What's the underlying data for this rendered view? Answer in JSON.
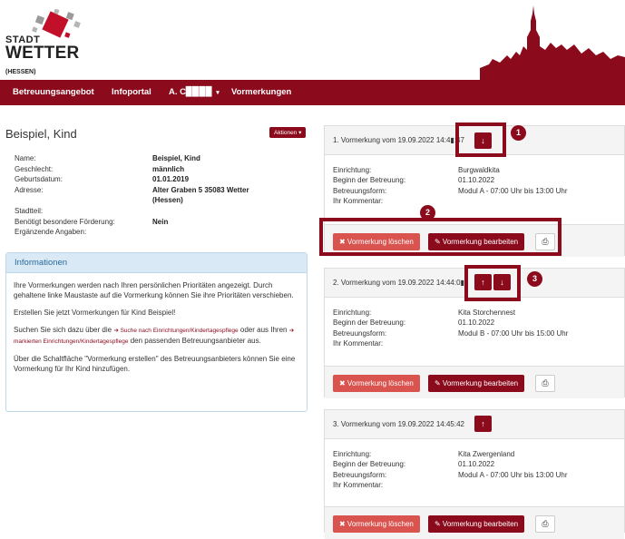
{
  "logo": {
    "line1": "STADT",
    "line2": "WETTER",
    "line3": "(HESSEN)"
  },
  "nav": {
    "items": [
      "Betreuungsangebot",
      "Infoportal",
      "A. C▉▉▉▉"
    ],
    "active": "Vormerkungen",
    "caret": "▾"
  },
  "person": {
    "name": "Beispiel, Kind",
    "actions_label": "Aktionen ▾",
    "fields": [
      {
        "label": "Name:",
        "value": "Beispiel, Kind"
      },
      {
        "label": "Geschlecht:",
        "value": "männlich"
      },
      {
        "label": "Geburtsdatum:",
        "value": "01.01.2019"
      },
      {
        "label": "Adresse:",
        "value": "Alter Graben 5 35083 Wetter"
      },
      {
        "label": "",
        "value": "(Hessen)"
      },
      {
        "label": "Stadtteil:",
        "value": ""
      },
      {
        "label": "Benötigt besondere Förderung:",
        "value": "Nein"
      },
      {
        "label": "Ergänzende Angaben:",
        "value": ""
      }
    ]
  },
  "info_panel": {
    "title": "Informationen",
    "p1": "Ihre Vormerkungen werden nach Ihren persönlichen Prioritäten angezeigt. Durch gehaltene linke Maustaste auf die Vormerkung können Sie ihre Prioritäten verschieben.",
    "p2": "Erstellen Sie jetzt Vormerkungen für Kind Beispiel!",
    "p3a": "Suchen Sie sich dazu über die",
    "p3_link1": "➔ Suche nach Einrichtungen/Kindertagespflege",
    "p3b": "oder aus Ihren",
    "p3_link2": "➔ markierten Einrichtungen/Kindertagespflege",
    "p3c": "den passenden Betreuungsanbieter aus.",
    "p4": "Über die Schaltfläche \"Vormerkung erstellen\" des Betreuungsanbieters können Sie eine Vormerkung für Ihr Kind hinzufügen."
  },
  "labels": {
    "einrichtung": "Einrichtung:",
    "beginn": "Beginn der Betreuung:",
    "form": "Betreuungsform:",
    "kommentar": "Ihr Kommentar:",
    "delete": "✖ Vormerkung löschen",
    "edit": "✎ Vormerkung bearbeiten",
    "print": "⎙"
  },
  "cards": [
    {
      "title": "1. Vormerkung vom 19.09.2022 14:4▮:47",
      "einrichtung": "Burgwaldkita",
      "beginn": "01.10.2022",
      "form": "Modul A - 07:00 Uhr bis 13:00 Uhr",
      "kommentar": ""
    },
    {
      "title": "2. Vormerkung vom 19.09.2022 14:44:0▮",
      "einrichtung": "Kita Storchennest",
      "beginn": "01.10.2022",
      "form": "Modul B - 07:00 Uhr bis 15:00 Uhr",
      "kommentar": ""
    },
    {
      "title": "3. Vormerkung vom 19.09.2022 14:45:42",
      "einrichtung": "Kita Zwergenland",
      "beginn": "01.10.2022",
      "form": "Modul A - 07:00 Uhr bis 13:00 Uhr",
      "kommentar": ""
    }
  ],
  "arrows": {
    "up": "↑",
    "down": "↓"
  },
  "callouts": [
    "1",
    "2",
    "3"
  ],
  "colors": {
    "brand": "#8b0a1c",
    "danger": "#d9534f",
    "info_head": "#d9eaf6"
  }
}
